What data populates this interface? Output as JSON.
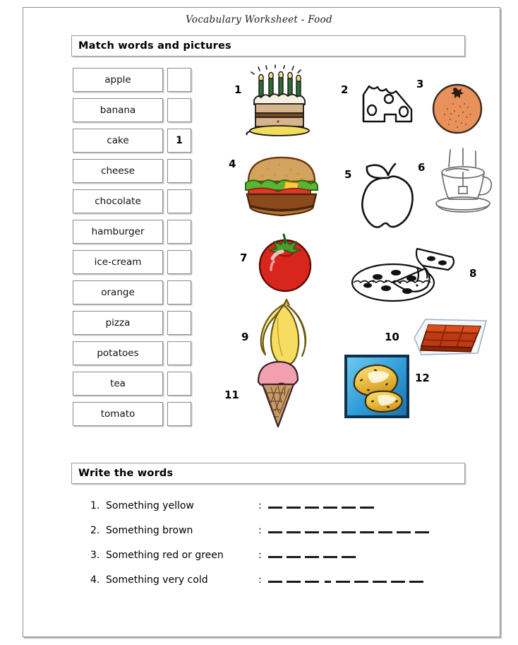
{
  "document": {
    "title": "Vocabulary Worksheet - Food"
  },
  "sections": {
    "match": {
      "heading": "Match words and pictures"
    },
    "write": {
      "heading": "Write the words"
    }
  },
  "word_list": [
    {
      "word": "apple",
      "answer": ""
    },
    {
      "word": "banana",
      "answer": ""
    },
    {
      "word": "cake",
      "answer": "1"
    },
    {
      "word": "cheese",
      "answer": ""
    },
    {
      "word": "chocolate",
      "answer": ""
    },
    {
      "word": "hamburger",
      "answer": ""
    },
    {
      "word": "ice-cream",
      "answer": ""
    },
    {
      "word": "orange",
      "answer": ""
    },
    {
      "word": "pizza",
      "answer": ""
    },
    {
      "word": "potatoes",
      "answer": ""
    },
    {
      "word": "tea",
      "answer": ""
    },
    {
      "word": "tomato",
      "answer": ""
    }
  ],
  "pictures": [
    {
      "number": "1",
      "item": "cake",
      "icon": "birthday-cake-icon"
    },
    {
      "number": "2",
      "item": "cheese",
      "icon": "cheese-wedge-icon"
    },
    {
      "number": "3",
      "item": "orange",
      "icon": "orange-fruit-icon"
    },
    {
      "number": "4",
      "item": "hamburger",
      "icon": "hamburger-icon"
    },
    {
      "number": "5",
      "item": "apple",
      "icon": "apple-outline-icon"
    },
    {
      "number": "6",
      "item": "tea",
      "icon": "teacup-icon"
    },
    {
      "number": "7",
      "item": "tomato",
      "icon": "tomato-icon"
    },
    {
      "number": "8",
      "item": "pizza",
      "icon": "pizza-icon"
    },
    {
      "number": "9",
      "item": "banana",
      "icon": "banana-icon"
    },
    {
      "number": "10",
      "item": "chocolate",
      "icon": "chocolate-bar-icon"
    },
    {
      "number": "11",
      "item": "ice-cream",
      "icon": "ice-cream-cone-icon"
    },
    {
      "number": "12",
      "item": "potatoes",
      "icon": "potatoes-icon"
    }
  ],
  "questions": [
    {
      "number": "1.",
      "prompt": "Something yellow",
      "colon": ":",
      "blanks": 6,
      "hyphen_after": 0
    },
    {
      "number": "2.",
      "prompt": "Something brown",
      "colon": ":",
      "blanks": 9,
      "hyphen_after": 0
    },
    {
      "number": "3.",
      "prompt": "Something red or green",
      "colon": ":",
      "blanks": 5,
      "hyphen_after": 0
    },
    {
      "number": "4.",
      "prompt": "Something very cold",
      "colon": ":",
      "blanks": 8,
      "hyphen_after": 3
    }
  ],
  "colors": {
    "page_border": "#8d8d8d",
    "box_border": "#8a8a8a",
    "orange": "#E8915A",
    "tomato_red": "#D8261E",
    "banana_yellow": "#F6DD62",
    "chocolate_brown": "#BE3A12",
    "bun_tan": "#D4A45E",
    "lettuce_green": "#57B733",
    "icecream_pink": "#F2A0B0",
    "cone_tan": "#C89A6B",
    "potato_yellow": "#F0C64B",
    "potato_bg_blue": "#3FA9DF",
    "cake_frosting": "#F2EDE0",
    "cake_layer": "#D6B48C",
    "candle_green": "#2E6B35",
    "lineart_gray": "#5a5a5a"
  }
}
